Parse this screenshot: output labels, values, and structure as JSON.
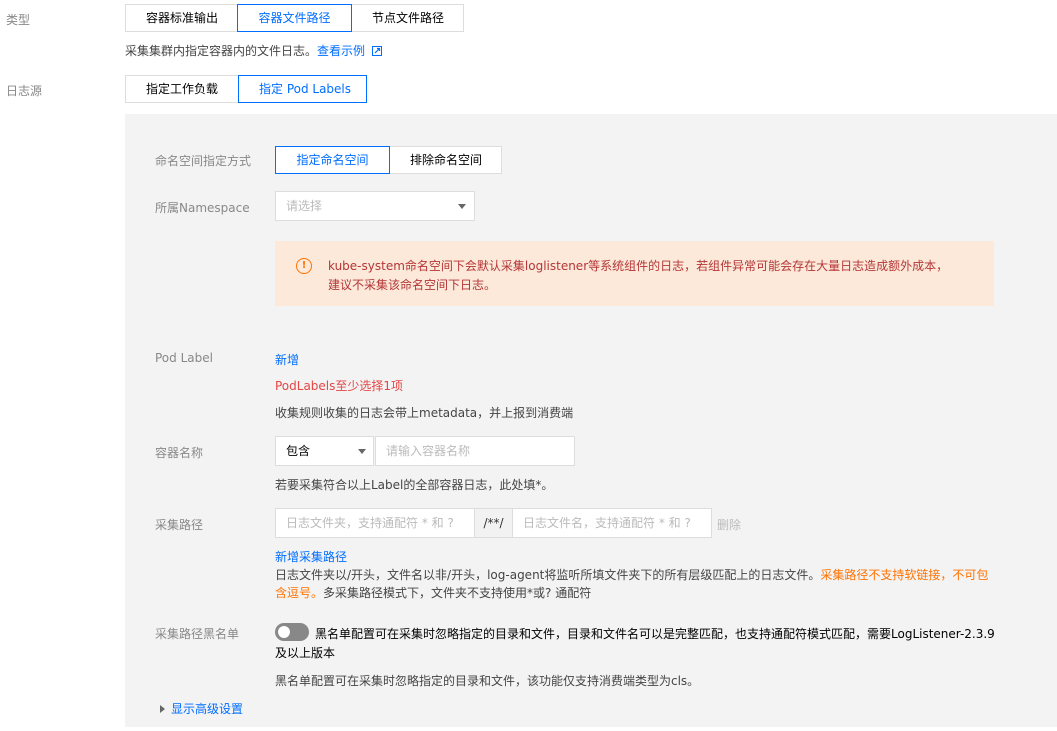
{
  "type_row": {
    "label": "类型",
    "options": [
      "容器标准输出",
      "容器文件路径",
      "节点文件路径"
    ],
    "active_index": 1,
    "desc": "采集集群内指定容器内的文件日志。",
    "example_link": "查看示例"
  },
  "log_source": {
    "label": "日志源",
    "options": [
      "指定工作负载",
      "指定 Pod Labels"
    ],
    "active_index": 1
  },
  "namespace_mode": {
    "label": "命名空间指定方式",
    "options": [
      "指定命名空间",
      "排除命名空间"
    ],
    "active_index": 0
  },
  "namespace": {
    "label": "所属Namespace",
    "placeholder": "请选择"
  },
  "alert": {
    "text": "kube-system命名空间下会默认采集loglistener等系统组件的日志，若组件异常可能会存在大量日志造成额外成本，建议不采集该命名空间下日志。"
  },
  "pod_label": {
    "label": "Pod Label",
    "add_link": "新增",
    "error": "PodLabels至少选择1项",
    "hint": "收集规则收集的日志会带上metadata，并上报到消费端"
  },
  "container_name": {
    "label": "容器名称",
    "select_value": "包含",
    "placeholder": "请输入容器名称",
    "hint": "若要采集符合以上Label的全部容器日志，此处填*。"
  },
  "collect_path": {
    "label": "采集路径",
    "dir_placeholder": "日志文件夹，支持通配符 * 和 ?",
    "separator": "/**/",
    "file_placeholder": "日志文件名，支持通配符 * 和 ?",
    "delete_label": "删除",
    "add_link": "新增采集路径",
    "hint_prefix": "日志文件夹以/开头，文件名以非/开头，log-agent将监听所填文件夹下的所有层级匹配上的日志文件。",
    "hint_warn": "采集路径不支持软链接，不可包含逗号。",
    "hint_suffix": "多采集路径模式下，文件夹不支持使用*或? 通配符"
  },
  "blacklist": {
    "label": "采集路径黑名单",
    "toggle_text": "黑名单配置可在采集时忽略指定的目录和文件，目录和文件名可以是完整匹配，也支持通配符模式匹配，需要LogListener-2.3.9及以上版本",
    "hint": "黑名单配置可在采集时忽略指定的目录和文件，该功能仅支持消费端类型为cls。",
    "enabled": false
  },
  "advanced": {
    "label": "显示高级设置"
  },
  "colors": {
    "primary": "#006eff",
    "error": "#e54545",
    "warn": "#ff7200",
    "panel_bg": "#f3f3f3",
    "alert_bg": "#fce9d9"
  }
}
